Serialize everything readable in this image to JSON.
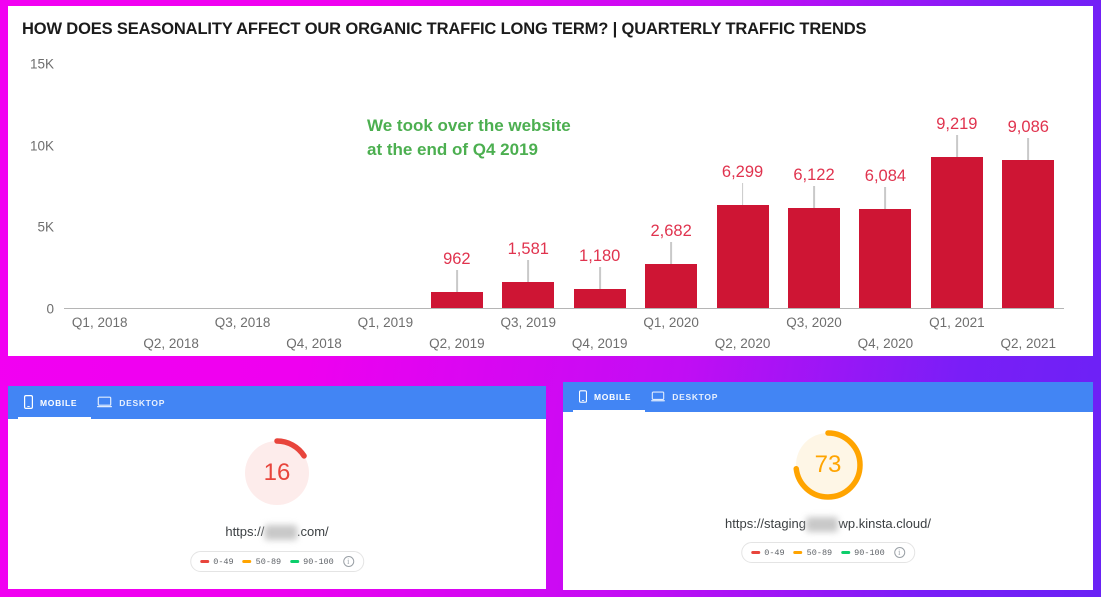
{
  "theme": {
    "bar_color": "#ce1534",
    "label_color": "#e0334e",
    "annotation_color": "#4caf50",
    "frame_gradient_start": "#f200f2",
    "frame_gradient_end": "#6a22f5",
    "tabbar_blue": "#4285f4"
  },
  "chart_card": {
    "title": "HOW DOES SEASONALITY AFFECT OUR ORGANIC TRAFFIC LONG TERM? | QUARTERLY TRAFFIC TRENDS",
    "annotation_line1": "We took over the website",
    "annotation_line2": "at the end of Q4 2019"
  },
  "chart_data": {
    "type": "bar",
    "title": "HOW DOES SEASONALITY AFFECT OUR ORGANIC TRAFFIC LONG TERM? | QUARTERLY TRAFFIC TRENDS",
    "xlabel": "",
    "ylabel": "",
    "ylim": [
      0,
      15000
    ],
    "yticks": [
      0,
      5000,
      10000,
      15000
    ],
    "ytick_labels": [
      "0",
      "5K",
      "10K",
      "15K"
    ],
    "grid": false,
    "legend": "none",
    "categories": [
      "Q1, 2018",
      "Q2, 2018",
      "Q3, 2018",
      "Q4, 2018",
      "Q1, 2019",
      "Q2, 2019",
      "Q3, 2019",
      "Q4, 2019",
      "Q1, 2020",
      "Q2, 2020",
      "Q3, 2020",
      "Q4, 2020",
      "Q1, 2021",
      "Q2, 2021"
    ],
    "values": [
      0,
      0,
      0,
      0,
      0,
      962,
      1581,
      1180,
      2682,
      6299,
      6122,
      6084,
      9219,
      9086
    ],
    "value_labels": [
      "",
      "",
      "",
      "",
      "",
      "962",
      "1,581",
      "1,180",
      "2,682",
      "6,299",
      "6,122",
      "6,084",
      "9,219",
      "9,086"
    ],
    "annotations": [
      {
        "text": "We took over the website at the end of Q4 2019",
        "color": "#4caf50"
      }
    ]
  },
  "pagespeed_left": {
    "tabs": [
      {
        "label": "MOBILE",
        "icon": "mobile-phone-icon",
        "active": true
      },
      {
        "label": "DESKTOP",
        "icon": "desktop-laptop-icon",
        "active": false
      }
    ],
    "score": "16",
    "score_color": "#e8453c",
    "score_track_color": "#fdeceb",
    "score_percent": 16,
    "url_prefix": "https://",
    "url_blurred": "xxxxx",
    "url_suffix": ".com/",
    "legend": [
      {
        "label": "0-49",
        "color": "#e8453c"
      },
      {
        "label": "50-89",
        "color": "#ffa400"
      },
      {
        "label": "90-100",
        "color": "#0cce6b"
      }
    ],
    "info_glyph": "i"
  },
  "pagespeed_right": {
    "tabs": [
      {
        "label": "MOBILE",
        "icon": "mobile-phone-icon",
        "active": true
      },
      {
        "label": "DESKTOP",
        "icon": "desktop-laptop-icon",
        "active": false
      }
    ],
    "score": "73",
    "score_color": "#ffa400",
    "score_track_color": "#fef6e6",
    "score_percent": 73,
    "url_prefix": "https://staging",
    "url_blurred": "xxxxx",
    "url_suffix": "wp.kinsta.cloud/",
    "legend": [
      {
        "label": "0-49",
        "color": "#e8453c"
      },
      {
        "label": "50-89",
        "color": "#ffa400"
      },
      {
        "label": "90-100",
        "color": "#0cce6b"
      }
    ],
    "info_glyph": "i"
  }
}
